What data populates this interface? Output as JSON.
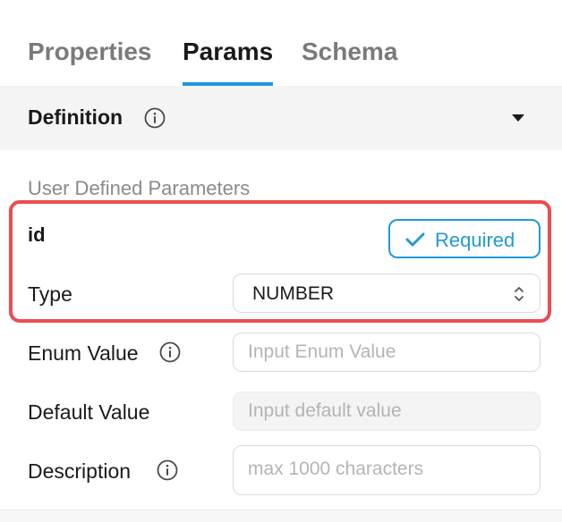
{
  "tabs": {
    "properties": "Properties",
    "params": "Params",
    "schema": "Schema",
    "active": "Params"
  },
  "definition": {
    "title": "Definition"
  },
  "params": {
    "section_label": "User Defined Parameters",
    "param_name": "id",
    "required_label": "Required",
    "type_label": "Type",
    "type_value": "NUMBER",
    "enum_label": "Enum Value",
    "enum_placeholder": "Input Enum Value",
    "default_label": "Default Value",
    "default_placeholder": "Input default value",
    "description_label": "Description",
    "description_placeholder": "max 1000 characters"
  },
  "colors": {
    "accent": "#1e9ad6",
    "highlight": "#ea4d51"
  }
}
